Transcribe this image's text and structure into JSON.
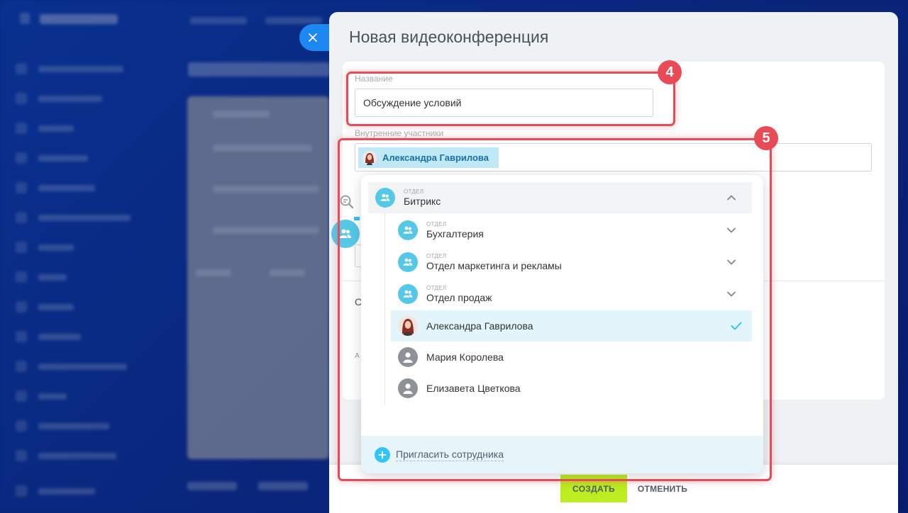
{
  "slider": {
    "title": "Новая видеоконференция",
    "name_label": "Название",
    "name_value": "Обсуждение условий",
    "participants_label": "Внутренние участники",
    "selected_participant": "Александра Гаврилова",
    "ghost_c": "С",
    "ghost_a": "А"
  },
  "popup": {
    "root": {
      "caption": "ОТДЕЛ",
      "title": "Битрикс"
    },
    "departments": [
      {
        "caption": "ОТДЕЛ",
        "title": "Бухгалтерия"
      },
      {
        "caption": "ОТДЕЛ",
        "title": "Отдел маркетинга и рекламы"
      },
      {
        "caption": "ОТДЕЛ",
        "title": "Отдел продаж"
      }
    ],
    "users": [
      {
        "name": "Александра Гаврилова",
        "selected": true
      },
      {
        "name": "Мария Королева",
        "selected": false
      },
      {
        "name": "Елизавета Цветкова",
        "selected": false
      }
    ],
    "invite_label": "Пригласить сотрудника"
  },
  "buttons": {
    "create": "СОЗДАТЬ",
    "cancel": "ОТМЕНИТЬ"
  },
  "annotations": {
    "badge_name": "4",
    "badge_participants": "5"
  },
  "colors": {
    "accent": "#2fc6f6",
    "department": "#55c8e8",
    "create_button": "#bbed21",
    "highlight": "#e84b55",
    "close_button": "#1e88f2"
  }
}
